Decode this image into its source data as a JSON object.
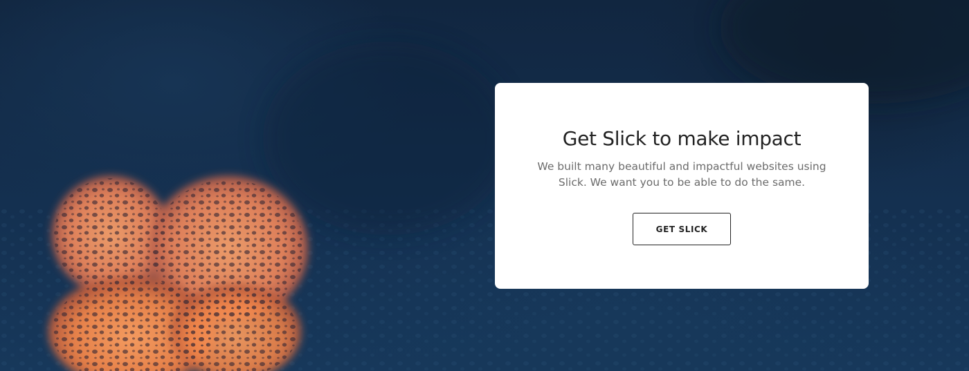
{
  "card": {
    "title": "Get Slick to make impact",
    "description": "We built many beautiful and impactful websites using Slick. We want you to be able to do the same.",
    "button_label": "GET SLICK"
  },
  "background": {
    "image": "dark-blue-droplets-orange-bokeh-photo",
    "base_color": "#143050",
    "accent_color": "#f08a55"
  }
}
